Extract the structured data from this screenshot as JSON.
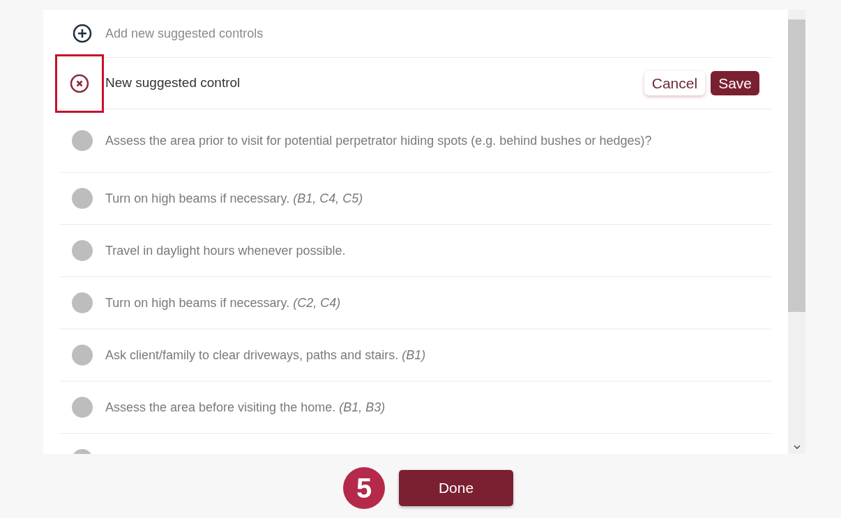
{
  "add_row": {
    "label": "Add new suggested controls"
  },
  "edit_row": {
    "value": "New suggested control",
    "highlighted": true,
    "buttons": [
      {
        "label": "Cancel",
        "kind": "secondary"
      },
      {
        "label": "Save",
        "kind": "primary"
      }
    ]
  },
  "items": [
    {
      "text": "Assess the area prior to visit for potential perpetrator hiding spots (e.g. behind bushes or hedges)?",
      "selected": false
    },
    {
      "text": "Turn on high beams if necessary. *(B1, C4, C5)*",
      "selected": false
    },
    {
      "text": "Travel in daylight hours whenever possible.",
      "selected": false
    },
    {
      "text": "Turn on high beams if necessary. *(C2, C4)*",
      "selected": false
    },
    {
      "text": "Ask client/family to clear driveways, paths and stairs. *(B1)*",
      "selected": false
    },
    {
      "text": "Assess the area before visiting the home. *(B1, B3)*",
      "selected": false
    },
    {
      "selected": false
    }
  ],
  "footer": {
    "step": "5",
    "button": "Done"
  }
}
